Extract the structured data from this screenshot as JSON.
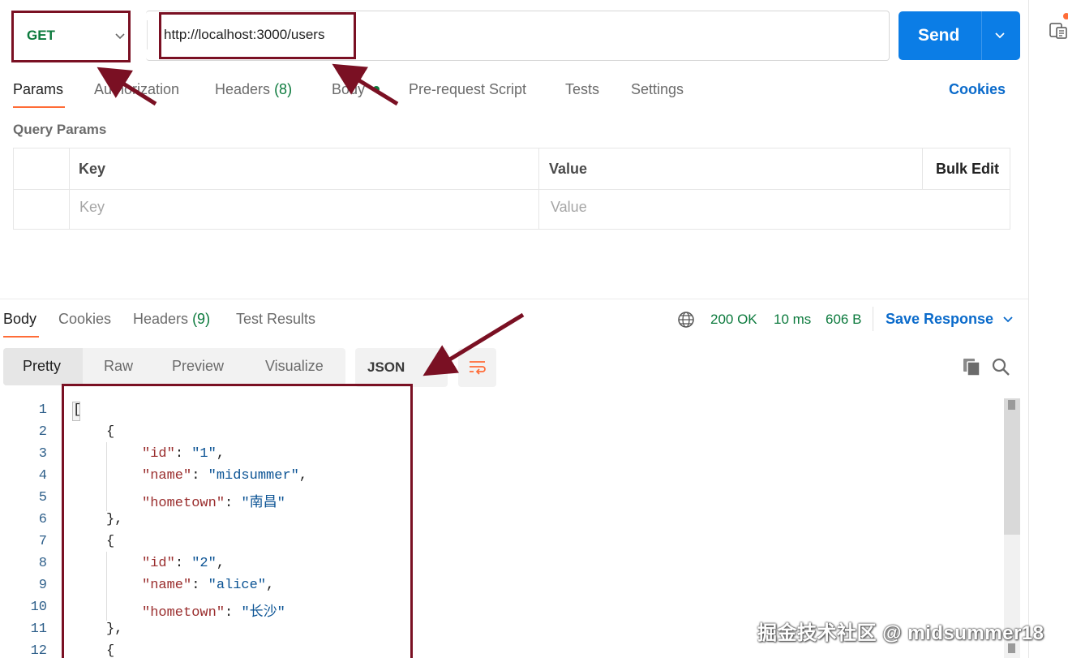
{
  "request": {
    "method": "GET",
    "url": "http://localhost:3000/users",
    "send_label": "Send"
  },
  "request_tabs": {
    "params": "Params",
    "authorization": "Authorization",
    "headers": "Headers",
    "headers_count": "(8)",
    "body": "Body",
    "pre_request": "Pre-request Script",
    "tests": "Tests",
    "settings": "Settings",
    "cookies": "Cookies"
  },
  "query_params": {
    "title": "Query Params",
    "col_key": "Key",
    "col_value": "Value",
    "bulk_edit": "Bulk Edit",
    "key_placeholder": "Key",
    "value_placeholder": "Value"
  },
  "response_tabs": {
    "body": "Body",
    "cookies": "Cookies",
    "headers": "Headers",
    "headers_count": "(9)",
    "test_results": "Test Results"
  },
  "response_meta": {
    "status": "200 OK",
    "time": "10 ms",
    "size": "606 B",
    "save_response": "Save Response"
  },
  "view_modes": {
    "pretty": "Pretty",
    "raw": "Raw",
    "preview": "Preview",
    "visualize": "Visualize",
    "format": "JSON"
  },
  "code": {
    "line_numbers": [
      "1",
      "2",
      "3",
      "4",
      "5",
      "6",
      "7",
      "8",
      "9",
      "10",
      "11",
      "12"
    ],
    "users": [
      {
        "id": "1",
        "name": "midsummer",
        "hometown": "南昌"
      },
      {
        "id": "2",
        "name": "alice",
        "hometown": "长沙"
      }
    ]
  },
  "watermark": "掘金技术社区 @ midsummer18",
  "colors": {
    "accent_orange": "#ff6c37",
    "send_blue": "#0b7de6",
    "success_green": "#0c7a3d",
    "highlight_maroon": "#7a1023"
  },
  "icons": [
    "chevron-down-icon",
    "globe-icon",
    "copy-icon",
    "search-icon",
    "wrap-lines-icon",
    "sidebar-panel-icon"
  ]
}
